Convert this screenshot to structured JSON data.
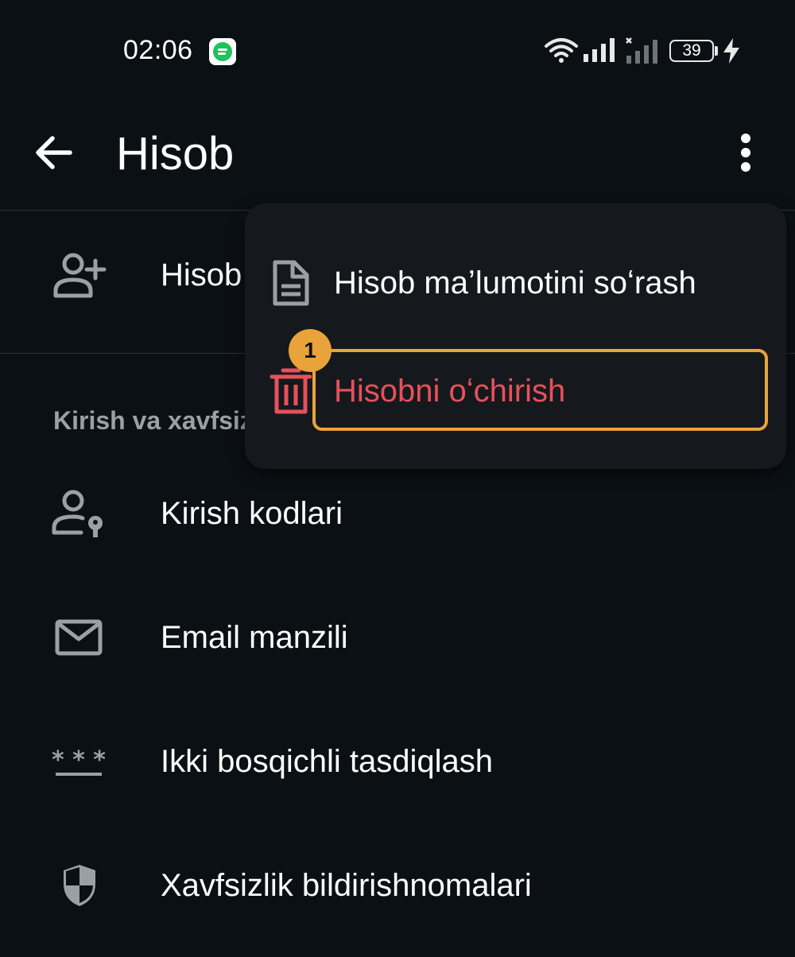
{
  "status_bar": {
    "time": "02:06",
    "battery_level": "39",
    "icons": [
      "notification-app-icon",
      "wifi-icon",
      "signal-icon",
      "signal-no-sim-icon",
      "battery-icon",
      "charging-bolt-icon"
    ]
  },
  "app_bar": {
    "title": "Hisob",
    "back_icon": "arrow-left-icon",
    "more_icon": "more-vertical-icon"
  },
  "list": {
    "add_account_label": "Hisob",
    "section_header": "Kirish va xavfsizlik",
    "items": [
      {
        "label": "Kirish kodlari",
        "icon": "person-key-icon"
      },
      {
        "label": "Email manzili",
        "icon": "mail-icon"
      },
      {
        "label": "Ikki bosqichli tasdiqlash",
        "icon": "password-dots-icon"
      },
      {
        "label": "Xavfsizlik bildirishnomalari",
        "icon": "shield-icon"
      }
    ]
  },
  "menu": {
    "items": [
      {
        "label": "Hisob maʼlumotini soʻrash",
        "icon": "document-icon",
        "color": "#ffffff"
      },
      {
        "label": "Hisobni oʻchirish",
        "icon": "trash-icon",
        "color": "#e8505b"
      }
    ]
  },
  "annotation": {
    "marker_number": "1",
    "highlight_color": "#e8a33a"
  },
  "colors": {
    "background": "#0b1014",
    "menu_background": "#15191d",
    "icon_gray": "#9aa0a6",
    "danger": "#e8505b"
  }
}
